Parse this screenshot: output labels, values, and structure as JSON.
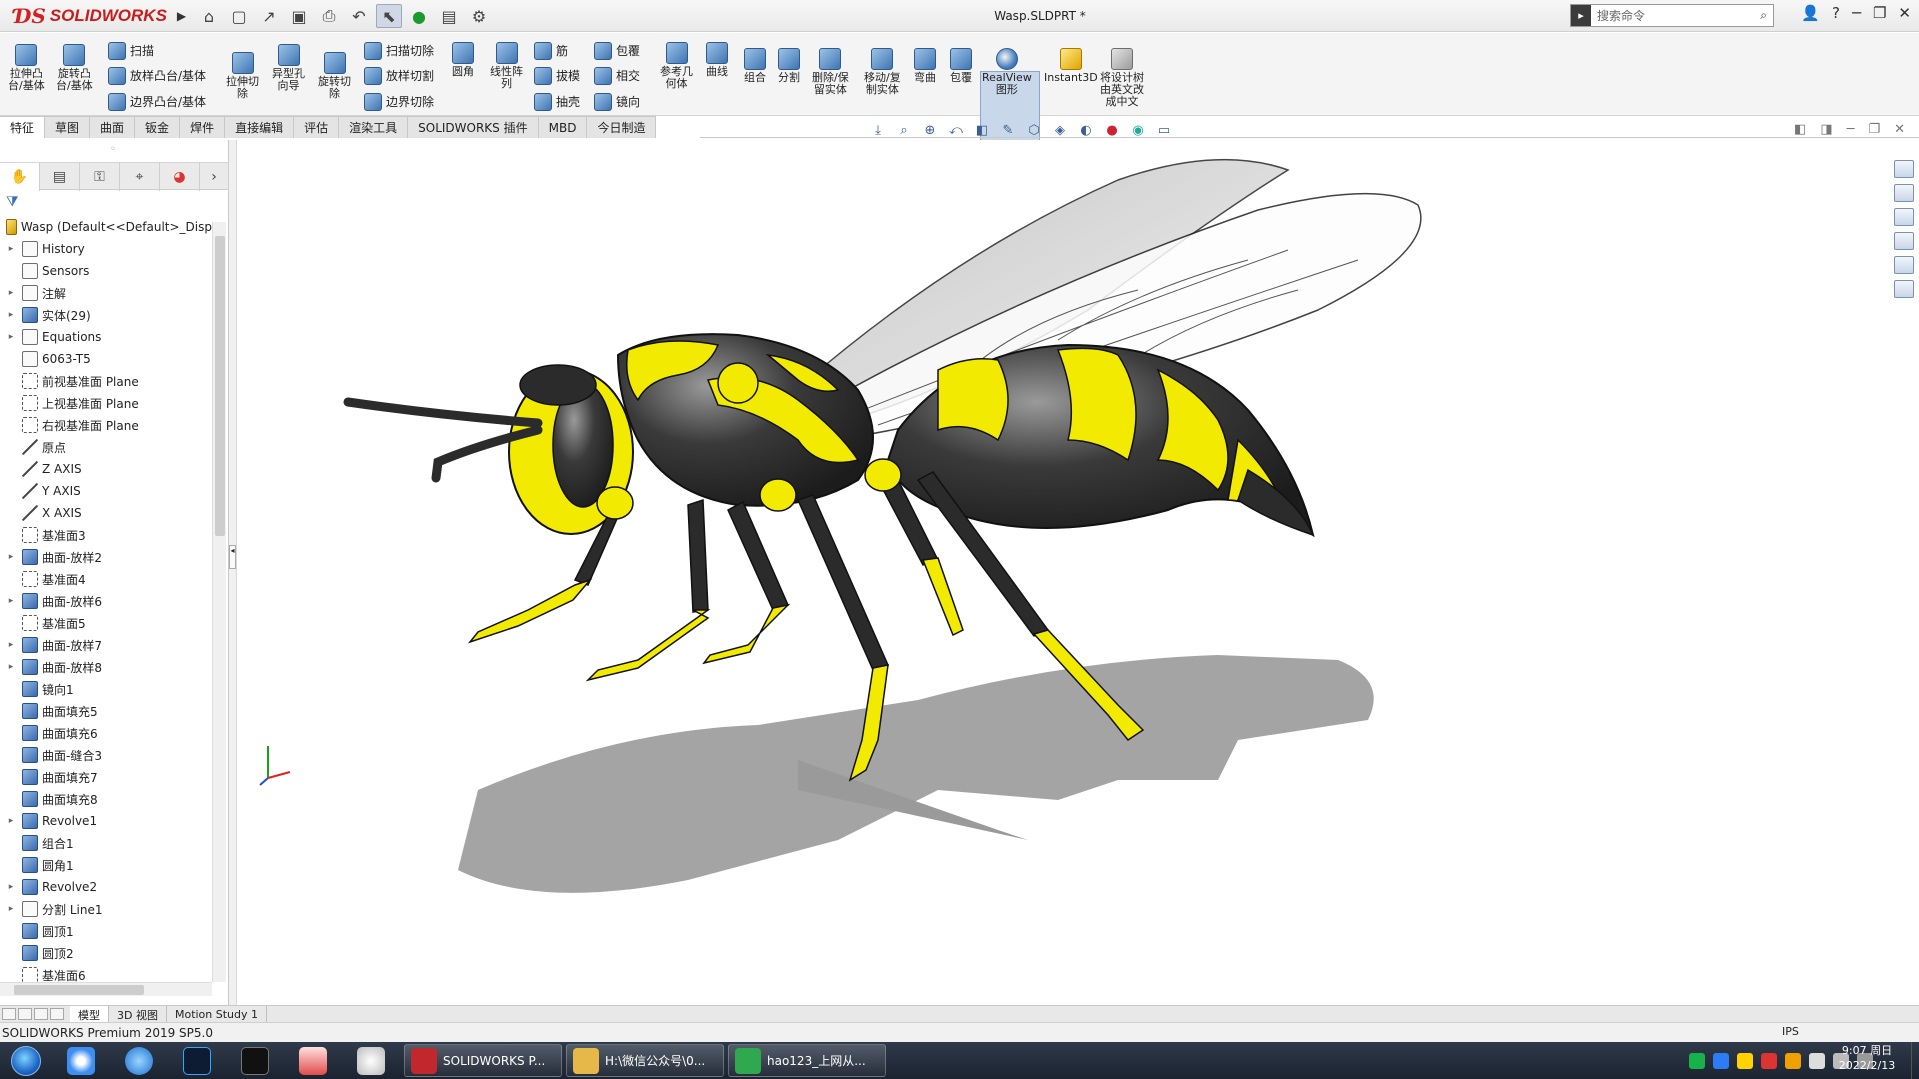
{
  "app": {
    "brand": "SOLIDWORKS",
    "window_title": "Wasp.SLDPRT *",
    "search_placeholder": "搜索命令"
  },
  "quick_access": [
    "home-icon",
    "new-icon",
    "open-icon",
    "save-icon",
    "print-icon",
    "undo-icon",
    "select-icon",
    "rebuild-icon",
    "file-props-icon",
    "options-icon"
  ],
  "ribbon": {
    "buttons": [
      {
        "id": "extrude-boss",
        "label": "拉伸凸\n台/基体"
      },
      {
        "id": "revolve-boss",
        "label": "旋转凸\n台/基体"
      },
      {
        "id": "sweep",
        "label": "扫描"
      },
      {
        "id": "loft-boss",
        "label": "放样凸台/基体"
      },
      {
        "id": "boundary-boss",
        "label": "边界凸台/基体"
      },
      {
        "id": "extrude-cut",
        "label": "拉伸切\n除"
      },
      {
        "id": "hole-wizard",
        "label": "异型孔\n向导"
      },
      {
        "id": "revolve-cut",
        "label": "旋转切\n除"
      },
      {
        "id": "swept-cut",
        "label": "扫描切除"
      },
      {
        "id": "lofted-cut",
        "label": "放样切割"
      },
      {
        "id": "boundary-cut",
        "label": "边界切除"
      },
      {
        "id": "fillet",
        "label": "圆角"
      },
      {
        "id": "linear-pattern",
        "label": "线性阵\n列"
      },
      {
        "id": "rib",
        "label": "筋"
      },
      {
        "id": "draft",
        "label": "拔模"
      },
      {
        "id": "shell",
        "label": "抽壳"
      },
      {
        "id": "wrap",
        "label": "包覆"
      },
      {
        "id": "intersect",
        "label": "相交"
      },
      {
        "id": "mirror",
        "label": "镜向"
      },
      {
        "id": "ref-geometry",
        "label": "参考几\n何体"
      },
      {
        "id": "curves",
        "label": "曲线"
      },
      {
        "id": "combine",
        "label": "组合"
      },
      {
        "id": "split",
        "label": "分割"
      },
      {
        "id": "delete-keep-body",
        "label": "删除/保\n留实体"
      },
      {
        "id": "move-copy-body",
        "label": "移动/复\n制实体"
      },
      {
        "id": "flex",
        "label": "弯曲"
      },
      {
        "id": "wrap2",
        "label": "包覆"
      },
      {
        "id": "realview",
        "label": "RealView\n图形"
      },
      {
        "id": "instant3d",
        "label": "Instant3D"
      },
      {
        "id": "translate-tree",
        "label": "将设计树\n由英文改\n成中文"
      }
    ]
  },
  "tabs": [
    "特征",
    "草图",
    "曲面",
    "钣金",
    "焊件",
    "直接编辑",
    "评估",
    "渲染工具",
    "SOLIDWORKS 插件",
    "MBD",
    "今日制造"
  ],
  "active_tab": 0,
  "feature_tree": {
    "root": "Wasp  (Default<<Default>_Disp",
    "items": [
      {
        "label": "History",
        "expand": true,
        "icon": "history-icon"
      },
      {
        "label": "Sensors",
        "expand": false,
        "icon": "sensor-icon"
      },
      {
        "label": "注解",
        "expand": true,
        "icon": "annotation-icon"
      },
      {
        "label": "实体(29)",
        "expand": true,
        "icon": "solid-bodies-icon"
      },
      {
        "label": "Equations",
        "expand": true,
        "icon": "equations-icon"
      },
      {
        "label": "6063-T5",
        "expand": false,
        "icon": "material-icon"
      },
      {
        "label": "前视基准面 Plane",
        "expand": false,
        "icon": "plane-icon"
      },
      {
        "label": "上视基准面 Plane",
        "expand": false,
        "icon": "plane-icon"
      },
      {
        "label": "右视基准面 Plane",
        "expand": false,
        "icon": "plane-icon"
      },
      {
        "label": "原点",
        "expand": false,
        "icon": "origin-icon"
      },
      {
        "label": "Z AXIS",
        "expand": false,
        "icon": "axis-icon"
      },
      {
        "label": "Y AXIS",
        "expand": false,
        "icon": "axis-icon"
      },
      {
        "label": "X AXIS",
        "expand": false,
        "icon": "axis-icon"
      },
      {
        "label": "基准面3",
        "expand": false,
        "icon": "plane-icon"
      },
      {
        "label": "曲面-放样2",
        "expand": true,
        "icon": "surface-loft-icon"
      },
      {
        "label": "基准面4",
        "expand": false,
        "icon": "plane-icon"
      },
      {
        "label": "曲面-放样6",
        "expand": true,
        "icon": "surface-loft-icon"
      },
      {
        "label": "基准面5",
        "expand": false,
        "icon": "plane-icon"
      },
      {
        "label": "曲面-放样7",
        "expand": true,
        "icon": "surface-loft-icon"
      },
      {
        "label": "曲面-放样8",
        "expand": true,
        "icon": "surface-loft-icon"
      },
      {
        "label": "镜向1",
        "expand": false,
        "icon": "mirror-icon"
      },
      {
        "label": "曲面填充5",
        "expand": false,
        "icon": "surface-fill-icon"
      },
      {
        "label": "曲面填充6",
        "expand": false,
        "icon": "surface-fill-icon"
      },
      {
        "label": "曲面-缝合3",
        "expand": false,
        "icon": "knit-icon"
      },
      {
        "label": "曲面填充7",
        "expand": false,
        "icon": "surface-fill-icon"
      },
      {
        "label": "曲面填充8",
        "expand": false,
        "icon": "surface-fill-icon"
      },
      {
        "label": "Revolve1",
        "expand": true,
        "icon": "revolve-icon"
      },
      {
        "label": "组合1",
        "expand": false,
        "icon": "combine-icon"
      },
      {
        "label": "圆角1",
        "expand": false,
        "icon": "fillet-icon"
      },
      {
        "label": "Revolve2",
        "expand": true,
        "icon": "revolve-icon"
      },
      {
        "label": "分割 Line1",
        "expand": true,
        "icon": "split-line-icon"
      },
      {
        "label": "圆顶1",
        "expand": false,
        "icon": "dome-icon"
      },
      {
        "label": "圆顶2",
        "expand": false,
        "icon": "dome-icon"
      },
      {
        "label": "基准面6",
        "expand": false,
        "icon": "plane-icon"
      }
    ]
  },
  "bottom_tabs": [
    "模型",
    "3D 视图",
    "Motion Study 1"
  ],
  "active_bottom_tab": 0,
  "status": {
    "text": "SOLIDWORKS Premium 2019 SP5.0",
    "units": "IPS"
  },
  "taskbar": {
    "windows": [
      {
        "label": "SOLIDWORKS P...",
        "color": "#c1272d"
      },
      {
        "label": "H:\\微信公众号\\0...",
        "color": "#e6b84a"
      },
      {
        "label": "hao123_上网从...",
        "color": "#2fa84f"
      }
    ],
    "clock_time": "9:07 周日",
    "clock_date": "2022/2/13"
  },
  "colors": {
    "wasp_yellow": "#f2ea00",
    "wasp_black": "#2b2b2b",
    "accent": "#3a6db5"
  }
}
